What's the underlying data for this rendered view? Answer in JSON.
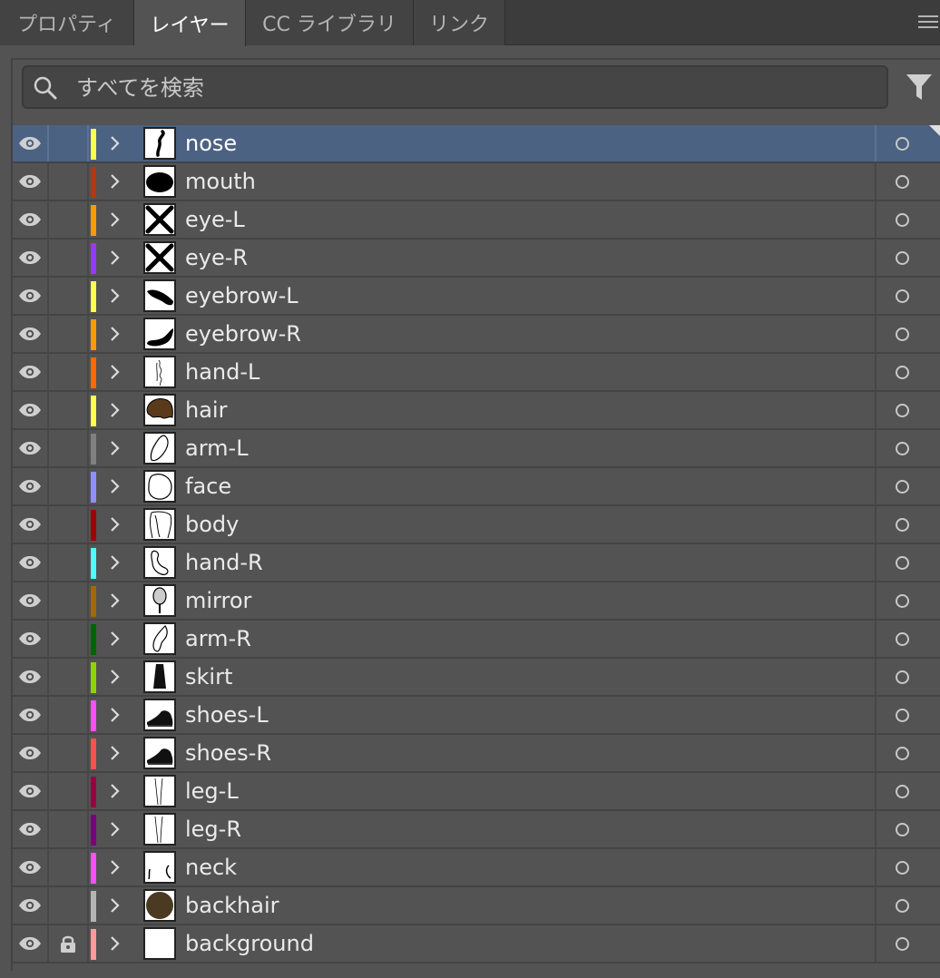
{
  "tabs": [
    {
      "label": "プロパティ",
      "active": false
    },
    {
      "label": "レイヤー",
      "active": true
    },
    {
      "label": "CC ライブラリ",
      "active": false
    },
    {
      "label": "リンク",
      "active": false
    }
  ],
  "search": {
    "placeholder": "すべてを検索",
    "value": ""
  },
  "layers": [
    {
      "name": "nose",
      "color": "#ffff4d",
      "thumb": "nose",
      "locked": false,
      "selected": true
    },
    {
      "name": "mouth",
      "color": "#b5370f",
      "thumb": "mouth",
      "locked": false,
      "selected": false
    },
    {
      "name": "eye-L",
      "color": "#ff9a00",
      "thumb": "eye-x",
      "locked": false,
      "selected": false
    },
    {
      "name": "eye-R",
      "color": "#9b36ff",
      "thumb": "eye-x",
      "locked": false,
      "selected": false
    },
    {
      "name": "eyebrow-L",
      "color": "#ffff4d",
      "thumb": "eyebrow-l",
      "locked": false,
      "selected": false
    },
    {
      "name": "eyebrow-R",
      "color": "#ff9a00",
      "thumb": "eyebrow-r",
      "locked": false,
      "selected": false
    },
    {
      "name": "hand-L",
      "color": "#ff6a00",
      "thumb": "hand-l",
      "locked": false,
      "selected": false
    },
    {
      "name": "hair",
      "color": "#ffff4d",
      "thumb": "hair",
      "locked": false,
      "selected": false
    },
    {
      "name": "arm-L",
      "color": "#808080",
      "thumb": "arm-l",
      "locked": false,
      "selected": false
    },
    {
      "name": "face",
      "color": "#8f8fff",
      "thumb": "face",
      "locked": false,
      "selected": false
    },
    {
      "name": "body",
      "color": "#a00000",
      "thumb": "body",
      "locked": false,
      "selected": false
    },
    {
      "name": "hand-R",
      "color": "#4dffff",
      "thumb": "hand-r",
      "locked": false,
      "selected": false
    },
    {
      "name": "mirror",
      "color": "#a06a00",
      "thumb": "mirror",
      "locked": false,
      "selected": false
    },
    {
      "name": "arm-R",
      "color": "#006400",
      "thumb": "arm-r",
      "locked": false,
      "selected": false
    },
    {
      "name": "skirt",
      "color": "#8fd400",
      "thumb": "skirt",
      "locked": false,
      "selected": false
    },
    {
      "name": "shoes-L",
      "color": "#ff4dff",
      "thumb": "shoe",
      "locked": false,
      "selected": false
    },
    {
      "name": "shoes-R",
      "color": "#ff5050",
      "thumb": "shoe",
      "locked": false,
      "selected": false
    },
    {
      "name": "leg-L",
      "color": "#9a0040",
      "thumb": "leg",
      "locked": false,
      "selected": false
    },
    {
      "name": "leg-R",
      "color": "#7a007a",
      "thumb": "leg",
      "locked": false,
      "selected": false
    },
    {
      "name": "neck",
      "color": "#ff4dff",
      "thumb": "neck",
      "locked": false,
      "selected": false
    },
    {
      "name": "backhair",
      "color": "#b4b4b4",
      "thumb": "backhair",
      "locked": false,
      "selected": false
    },
    {
      "name": "background",
      "color": "#ff9a9a",
      "thumb": "blank",
      "locked": true,
      "selected": false
    }
  ],
  "icons": {
    "visibility": "eye-icon",
    "lock": "lock-icon",
    "expand": "chevron-right-icon",
    "target": "target-circle-icon",
    "search": "search-icon",
    "filter": "filter-icon",
    "menu": "hamburger-menu-icon"
  },
  "colors": {
    "panel_bg": "#535353",
    "tabbar_bg": "#3c3c3c",
    "selected_row": "#4b6282"
  }
}
